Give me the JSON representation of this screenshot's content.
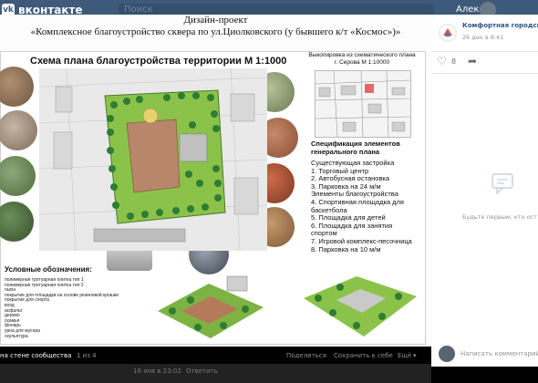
{
  "header": {
    "app_name": "вконтакте",
    "search_text": "Поиск",
    "user_name": "Алексей"
  },
  "photo": {
    "title_line1": "Дизайн-проект",
    "title_line2": "«Комплексное благоустройство сквера по ул.Циолковского (у бывшего к/т «Космос»)»",
    "schema_title": "Схема плана благоустройства территории М 1:1000",
    "inset_title": "Выкопировка из схематического плана г. Серова М 1:10000",
    "spec_title": "Спецификация элементов генерального плана",
    "spec_items": [
      "Существующая застройка",
      "1. Торговый центр",
      "2. Автобусная остановка",
      "3. Парковка на 24 м/м",
      "Элементы благоустройства",
      "4. Спортивная площадка для",
      "    баскетбола",
      "5. Площадка для детей",
      "6. Площадка для занятия",
      "    спортом",
      "7. Игровой комплекс-песочница",
      "8. Парковка на 10 м/м"
    ],
    "legend_title": "Условные обозначения:",
    "legend_items": [
      "полимерная тротуарная плитка тип 1",
      "полимерная тротуарная плитка тип 2",
      "газон",
      "покрытие для площадки на основе резиновой крошки",
      "покрытие для спорта",
      "вход",
      "асфальт",
      "дерево",
      "скамья",
      "фонарь",
      "урна для мусора",
      "скульптура"
    ]
  },
  "sidebar": {
    "community_name": "Комфортная городская с",
    "post_date": "26 дек в 8:41",
    "likes_count": "8",
    "empty_comments_text": "Будьте первым, кто ост комментарий к этой фото"
  },
  "footer": {
    "album_text": "на стене сообщества",
    "counter": "1 из 4",
    "share_label": "Поделиться",
    "save_label": "Сохранить к себе",
    "more_label": "Ещё",
    "comment_placeholder": "Написать комментарий...",
    "reply_time": "16 янв в 23:02",
    "reply_label": "Ответить"
  },
  "colors": {
    "vk_blue": "#3d5a7a",
    "link": "#2a5885"
  }
}
